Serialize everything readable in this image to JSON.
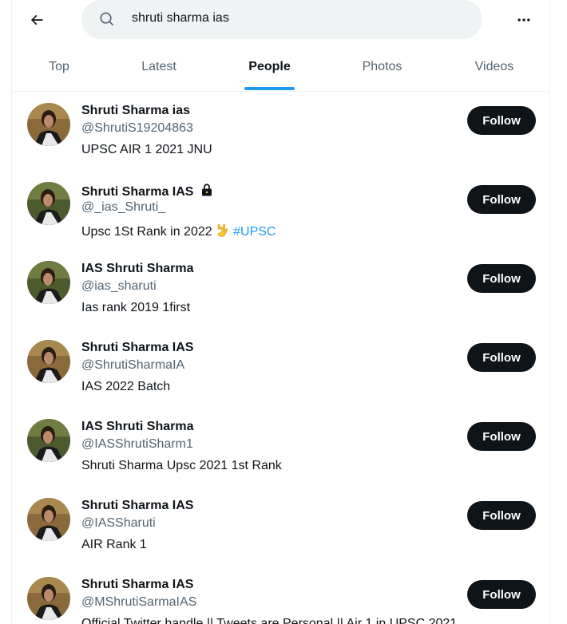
{
  "search": {
    "query": "shruti sharma ias"
  },
  "tabs": [
    {
      "label": "Top"
    },
    {
      "label": "Latest"
    },
    {
      "label": "People"
    },
    {
      "label": "Photos"
    },
    {
      "label": "Videos"
    }
  ],
  "active_tab": "People",
  "users": [
    {
      "name": "Shruti Sharma ias",
      "handle": "@ShrutiS19204863",
      "bio": "UPSC AIR 1 2021 JNU",
      "follow_label": "Follow"
    },
    {
      "name": "Shruti Sharma IAS",
      "handle": "@_ias_Shruti_",
      "bio": "Upsc 1St Rank in 2022",
      "bio_hashtag": "#UPSC",
      "follow_label": "Follow"
    },
    {
      "name": "IAS Shruti Sharma",
      "handle": "@ias_sharuti",
      "bio": "Ias rank 2019 1first",
      "follow_label": "Follow"
    },
    {
      "name": "Shruti Sharma IAS",
      "handle": "@ShrutiSharmaIA",
      "bio": "IAS 2022 Batch",
      "follow_label": "Follow"
    },
    {
      "name": "IAS Shruti Sharma",
      "handle": "@IASShrutiSharm1",
      "bio": "Shruti Sharma Upsc 2021 1st Rank",
      "follow_label": "Follow"
    },
    {
      "name": "Shruti Sharma IAS",
      "handle": "@IASSharuti",
      "bio": "AIR Rank 1",
      "follow_label": "Follow"
    },
    {
      "name": "Shruti Sharma IAS",
      "handle": "@MShrutiSarmaIAS",
      "bio": "Official Twitter handle || Tweets are Personal || Air 1 in UPSC 2021",
      "follow_label": "Follow"
    }
  ],
  "colors": {
    "accent": "#1d9bf0",
    "text_primary": "#0f1419",
    "text_secondary": "#536471",
    "follow_bg": "#0f1419"
  }
}
